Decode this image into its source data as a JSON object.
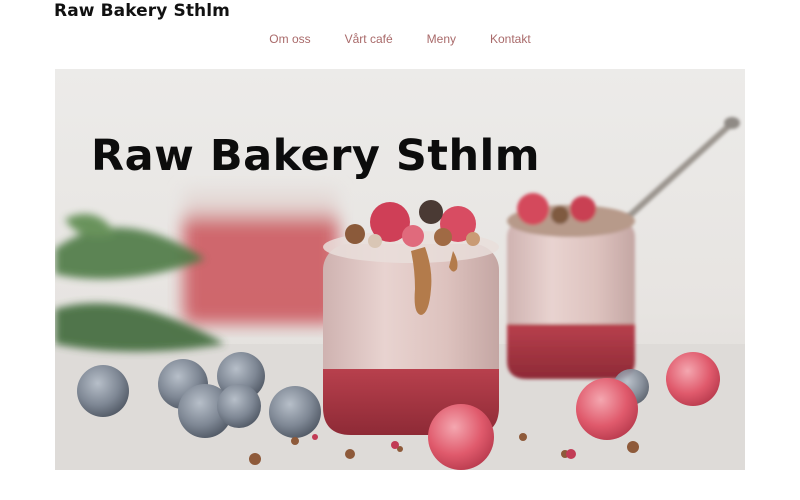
{
  "header": {
    "site_title": "Raw Bakery Sthlm"
  },
  "nav": {
    "items": [
      {
        "label": "Om oss"
      },
      {
        "label": "Vårt café"
      },
      {
        "label": "Meny"
      },
      {
        "label": "Kontakt"
      }
    ]
  },
  "hero": {
    "title": "Raw Bakery Sthlm",
    "image": "chia-pudding-jars-with-berries-photo"
  },
  "colors": {
    "nav_link": "#a96a6a",
    "title": "#111111"
  }
}
